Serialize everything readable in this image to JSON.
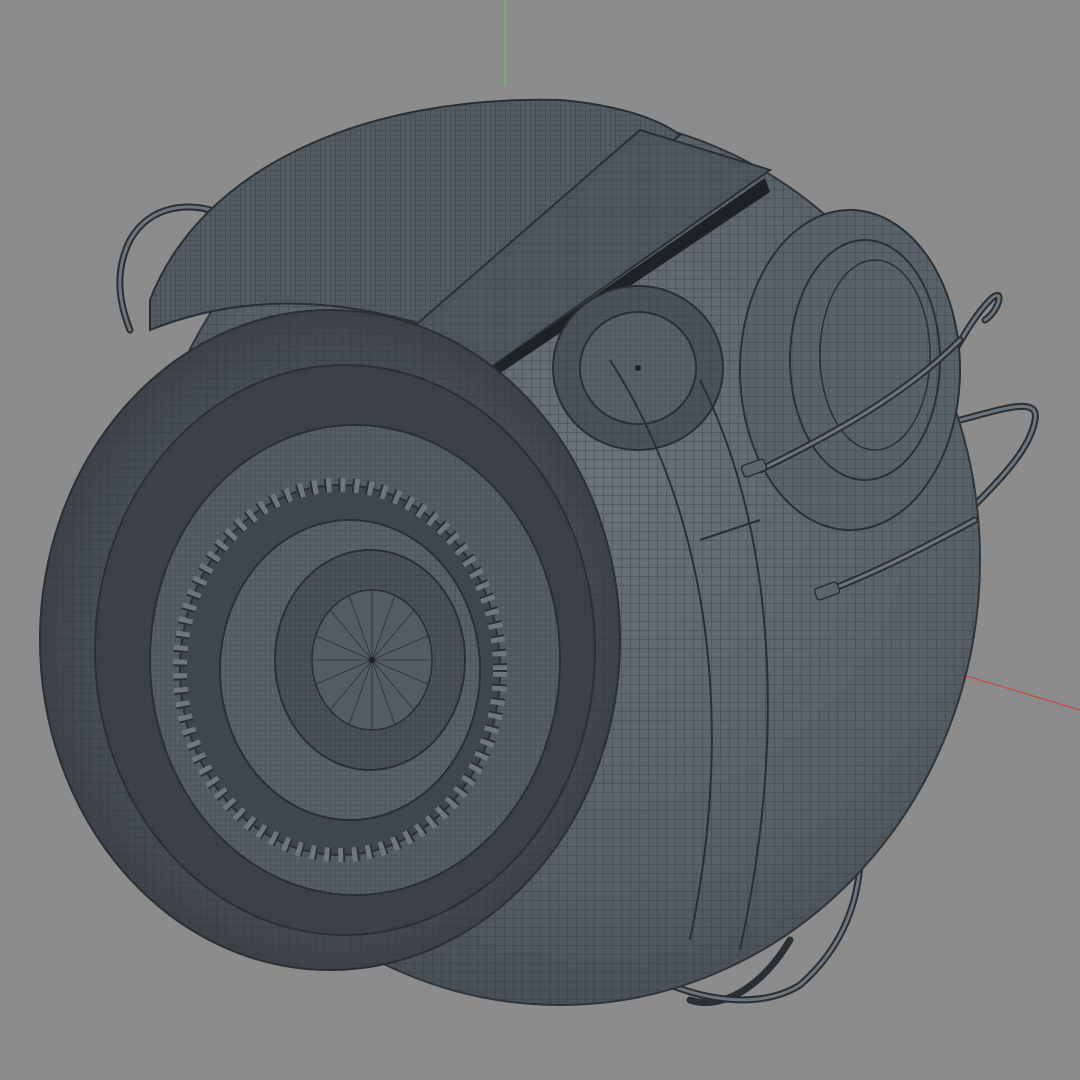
{
  "viewport": {
    "background_color": "#8c8c8c",
    "mesh_fill_color": "#5c646b",
    "mesh_dark_color": "#3a4046",
    "wire_color": "#2a2f34",
    "axis_y_color": "#4fd05a",
    "axis_x_color": "#d04040",
    "axes_visible": true,
    "shading_mode": "wireframe-on-shaded",
    "object": "sphere-robot-model"
  }
}
